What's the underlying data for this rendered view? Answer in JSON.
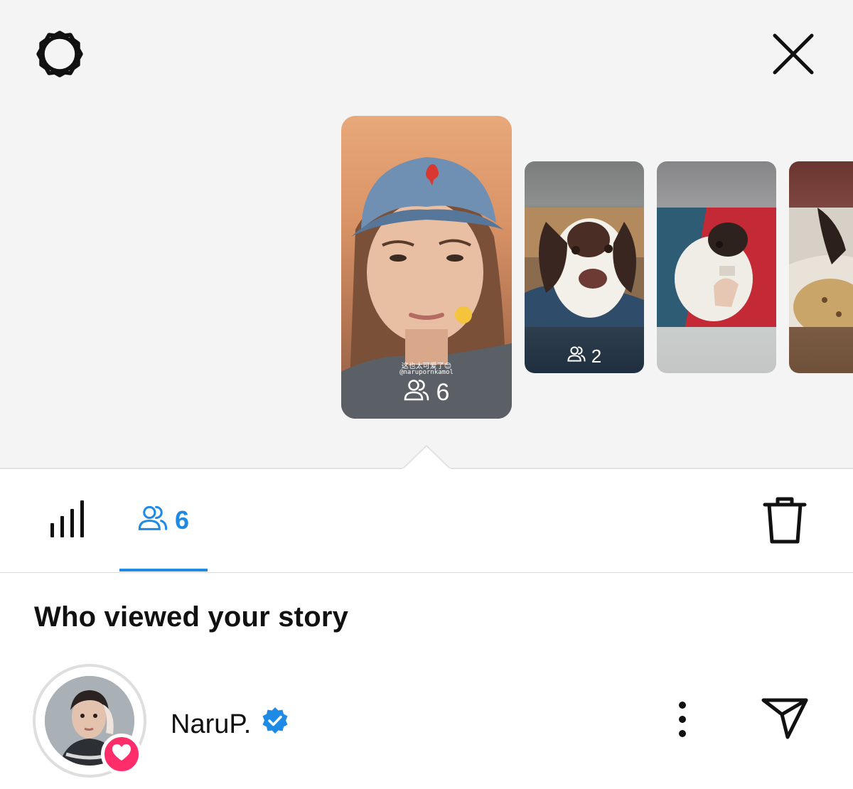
{
  "header": {
    "settings_icon": "gear-icon",
    "close_icon": "close-icon"
  },
  "stories": [
    {
      "caption_line_1": "这也太可爱了😊",
      "caption_line_2": "@narupornkamol",
      "viewer_count": "6",
      "selected": true
    },
    {
      "viewer_count": "2",
      "selected": false
    },
    {
      "viewer_count": "",
      "selected": false
    },
    {
      "viewer_count": "",
      "selected": false
    }
  ],
  "tabs": {
    "insights_icon": "bar-chart-icon",
    "viewers_icon": "viewers-icon",
    "viewers_count": "6",
    "delete_icon": "trash-icon"
  },
  "viewers_section": {
    "title": "Who viewed your story",
    "viewers": [
      {
        "name": "NaruP.",
        "verified": true,
        "liked": true
      }
    ]
  },
  "colors": {
    "accent": "#1d8ae6",
    "like": "#ff2d6a",
    "verified": "#1d8ae6",
    "top_background": "#f4f4f4"
  }
}
